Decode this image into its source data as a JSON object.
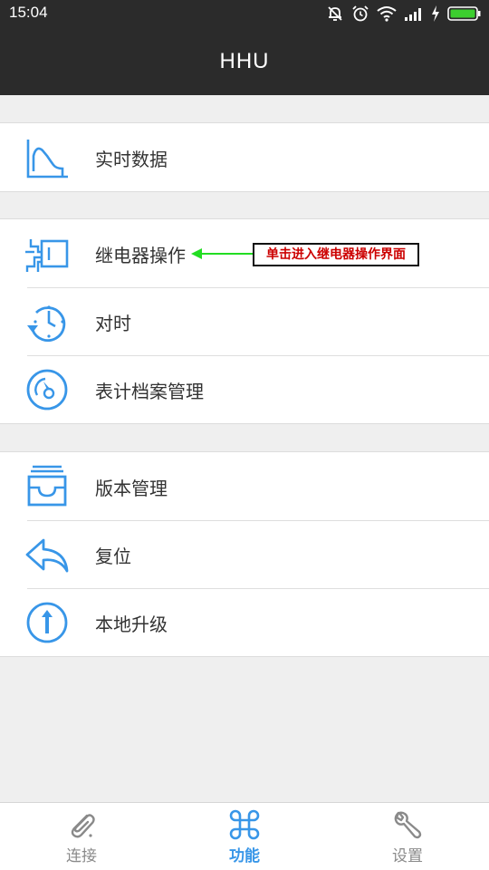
{
  "status_bar": {
    "time": "15:04"
  },
  "app_bar": {
    "title": "HHU"
  },
  "groups": [
    {
      "items": [
        {
          "label": "实时数据",
          "icon": "line-chart-icon"
        }
      ]
    },
    {
      "items": [
        {
          "label": "继电器操作",
          "icon": "relay-icon"
        },
        {
          "label": "对时",
          "icon": "clock-sync-icon"
        },
        {
          "label": "表计档案管理",
          "icon": "meter-gauge-icon"
        }
      ]
    },
    {
      "items": [
        {
          "label": "版本管理",
          "icon": "inbox-tray-icon"
        },
        {
          "label": "复位",
          "icon": "reply-arrow-icon"
        },
        {
          "label": "本地升级",
          "icon": "upload-circle-icon"
        }
      ]
    }
  ],
  "annotation": {
    "text": "单击进入继电器操作界面"
  },
  "bottom_nav": {
    "active_index": 1,
    "items": [
      {
        "label": "连接",
        "icon": "paperclip-icon"
      },
      {
        "label": "功能",
        "icon": "command-icon"
      },
      {
        "label": "设置",
        "icon": "wrench-icon"
      }
    ]
  },
  "colors": {
    "accent": "#3896e8",
    "bar": "#2b2b2b",
    "annotation_text": "#cc0000",
    "annotation_arrow": "#22dd22"
  }
}
